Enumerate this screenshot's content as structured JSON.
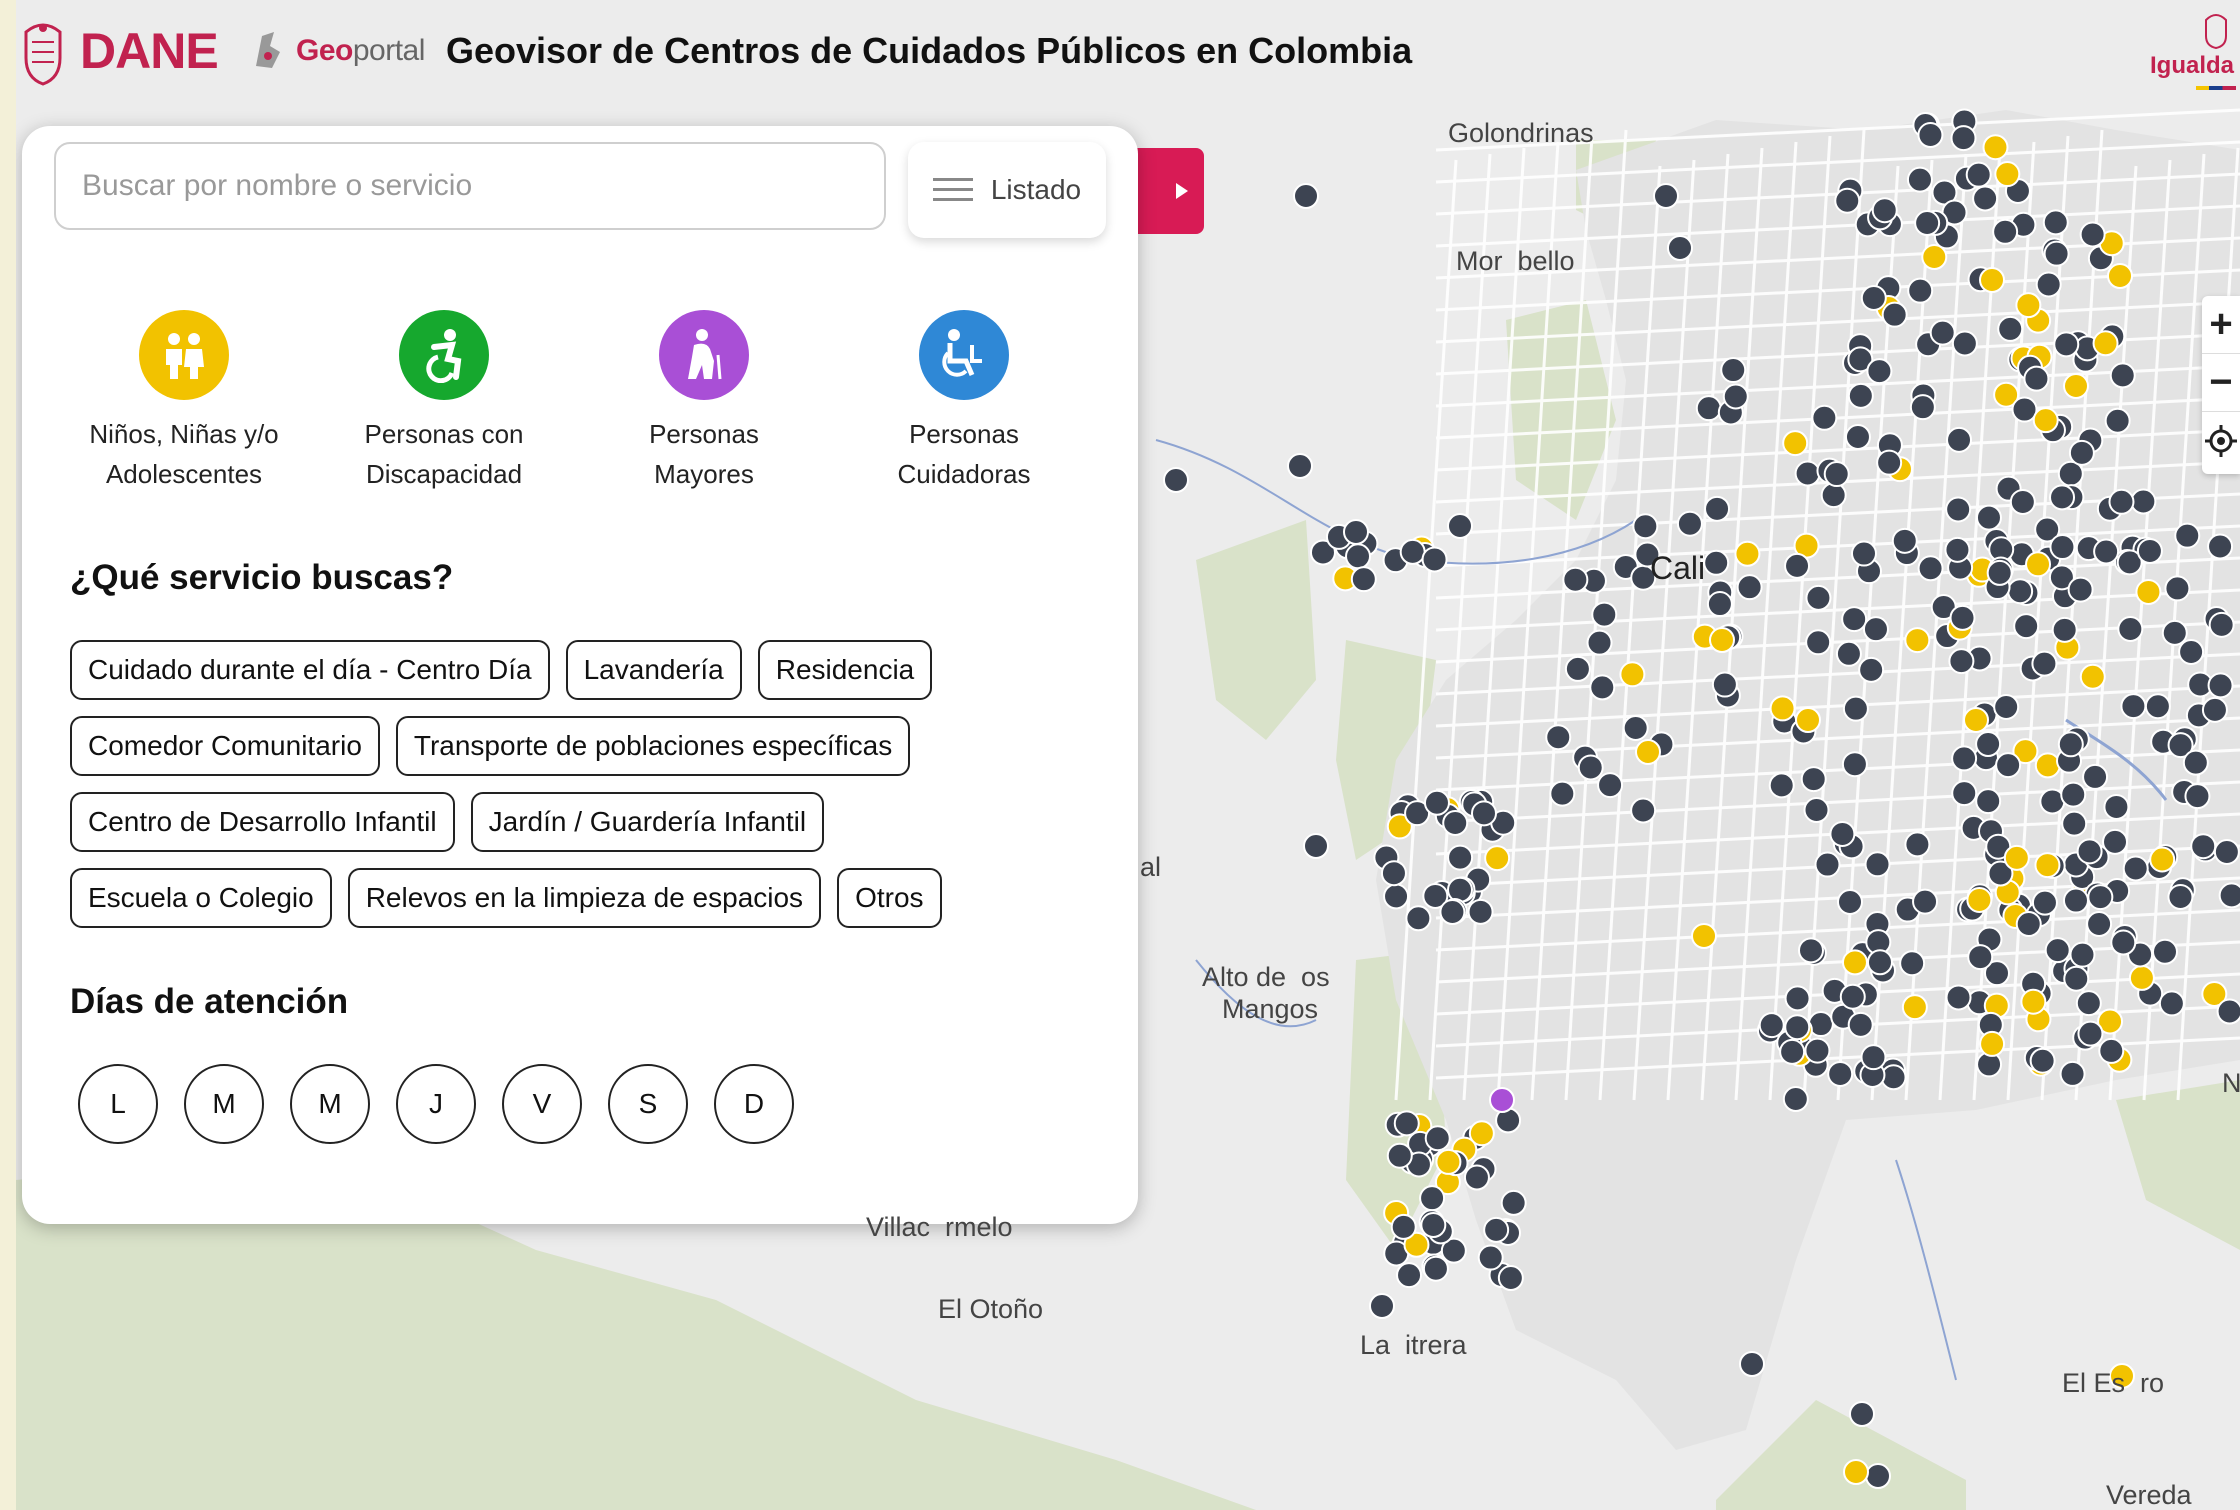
{
  "header": {
    "dane_logo_text": "DANE",
    "geoportal_geo": "Geo",
    "geoportal_portal": "portal",
    "title": "Geovisor de Centros de Cuidados Públicos en Colombia",
    "igualdad_logo_text": "Igualda"
  },
  "search": {
    "placeholder": "Buscar por nombre o servicio",
    "list_button_label": "Listado"
  },
  "categories": [
    {
      "label": "Niños, Niñas y/o\nAdolescentes",
      "color": "#f2c200",
      "icon": "children-icon"
    },
    {
      "label": "Personas con\nDiscapacidad",
      "color": "#16a82e",
      "icon": "accessible-active-icon"
    },
    {
      "label": "Personas\nMayores",
      "color": "#a94fd6",
      "icon": "elderly-person-icon"
    },
    {
      "label": "Personas\nCuidadoras",
      "color": "#2f88d6",
      "icon": "wheelchair-caregiver-icon"
    }
  ],
  "services": {
    "title": "¿Qué servicio buscas?",
    "rows": [
      [
        "Cuidado durante el día - Centro Día",
        "Lavandería",
        "Residencia"
      ],
      [
        "Comedor Comunitario",
        "Transporte de poblaciones específicas"
      ],
      [
        "Centro de Desarrollo Infantil",
        "Jardín / Guardería Infantil"
      ],
      [
        "Escuela o Colegio",
        "Relevos en la limpieza de espacios",
        "Otros"
      ]
    ]
  },
  "days": {
    "title": "Días de atención",
    "items": [
      "L",
      "M",
      "M",
      "J",
      "V",
      "S",
      "D"
    ]
  },
  "map": {
    "zoom_in": "+",
    "zoom_out": "−",
    "labels": {
      "golondrinas": "Golondrinas",
      "morabello": "Mor  bello",
      "cali": "Cali",
      "alto_de_los_mangos_1": "Alto de  os",
      "alto_de_los_mangos_2": "Mangos",
      "el_otono": "El Otoño",
      "la_buitrera": "La  itrera",
      "el_estero": "El Es  ro",
      "vereda": "Vereda",
      "villacarmelo": "Villac  rmelo",
      "al": "al",
      "n": "N"
    },
    "marker_colors": {
      "dark": "#3d4452",
      "yellow": "#f2c200",
      "purple": "#a94fd6"
    }
  }
}
